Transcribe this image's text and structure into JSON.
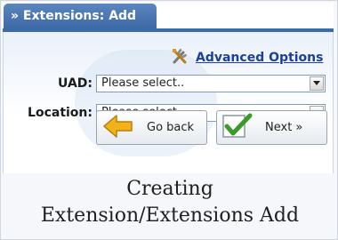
{
  "panel": {
    "tab_label": "» Extensions: Add"
  },
  "advanced_options": {
    "label": "Advanced Options",
    "icon": "tools-icon"
  },
  "form": {
    "uad": {
      "label": "UAD:",
      "value": "Please select.."
    },
    "location": {
      "label": "Location:",
      "value": "Please select.."
    }
  },
  "buttons": {
    "back": {
      "label": "Go back",
      "icon": "arrow-left-icon"
    },
    "next": {
      "label": "Next »",
      "icon": "checkmark-icon"
    }
  },
  "caption": {
    "line1": "Creating",
    "line2": "Extension/Extensions Add"
  },
  "colors": {
    "tab": "#3e6aa6",
    "link": "#1a3fa0",
    "back_arrow": "#f2b21c",
    "check": "#3a9a2a"
  }
}
